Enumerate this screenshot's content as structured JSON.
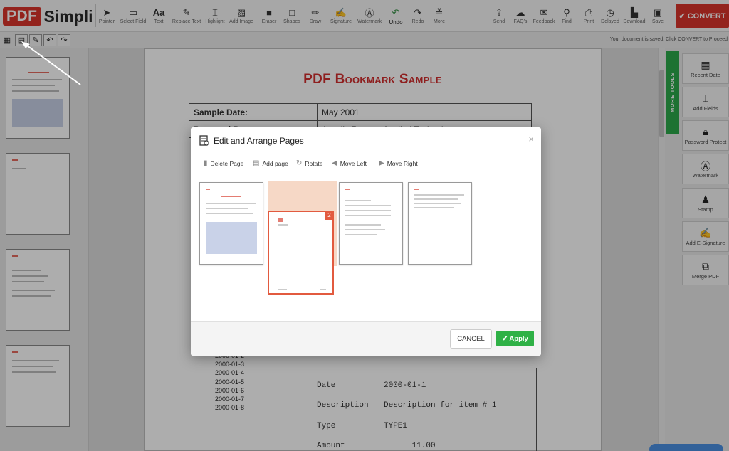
{
  "logo": {
    "pdf": "PDF",
    "simpli": "Simpli"
  },
  "toolbar": {
    "tools": [
      {
        "label": "Pointer",
        "icon": "pointer-icon"
      },
      {
        "label": "Select Field",
        "icon": "select-field-icon"
      },
      {
        "label": "Text",
        "icon": "text-icon"
      },
      {
        "label": "Replace Text",
        "icon": "replace-text-icon"
      },
      {
        "label": "Highlight",
        "icon": "highlight-icon"
      },
      {
        "label": "Add Image",
        "icon": "image-icon"
      },
      {
        "label": "Eraser",
        "icon": "eraser-icon"
      },
      {
        "label": "Shapes",
        "icon": "shapes-icon"
      },
      {
        "label": "Draw",
        "icon": "pencil-icon"
      },
      {
        "label": "Signature",
        "icon": "signature-icon"
      },
      {
        "label": "Watermark",
        "icon": "watermark-icon"
      },
      {
        "label": "Undo",
        "icon": "undo-icon"
      },
      {
        "label": "Redo",
        "icon": "redo-icon"
      },
      {
        "label": "More",
        "icon": "more-icon"
      }
    ],
    "right_tools": [
      {
        "label": "Send",
        "icon": "send-icon"
      },
      {
        "label": "FAQ's",
        "icon": "faq-icon"
      },
      {
        "label": "Feedback",
        "icon": "feedback-icon"
      },
      {
        "label": "Find",
        "icon": "search-icon"
      },
      {
        "label": "Print",
        "icon": "print-icon"
      },
      {
        "label": "Delayed",
        "icon": "clock-icon"
      },
      {
        "label": "Download",
        "icon": "download-icon"
      },
      {
        "label": "Save",
        "icon": "save-icon"
      }
    ],
    "convert_label": "✔ CONVERT"
  },
  "subbar": {
    "saved_message": "Your document is saved. Click CONVERT to Proceed"
  },
  "document": {
    "title": "PDF Bookmark Sample",
    "table": [
      {
        "label": "Sample Date:",
        "value": "May 2001"
      },
      {
        "label": "Prepared By:",
        "value": "Accelio Present Applied Technology"
      }
    ],
    "tree_items": [
      "2000-01-2",
      "2000-01-3",
      "2000-01-4",
      "2000-01-5",
      "2000-01-6",
      "2000-01-7",
      "2000-01-8"
    ],
    "record": [
      {
        "key": "Date",
        "value": "2000-01-1"
      },
      {
        "key": "Description",
        "value": "Description for item # 1"
      },
      {
        "key": "Type",
        "value": "TYPE1"
      },
      {
        "key": "Amount",
        "value": "      11.00"
      }
    ]
  },
  "right_panel": {
    "more_tools": "MORE TOOLS",
    "items": [
      {
        "label": "Recent Date",
        "icon": "calendar-icon"
      },
      {
        "label": "Add Fields",
        "icon": "add-fields-icon"
      },
      {
        "label": "Password Protect",
        "icon": "lock-icon"
      },
      {
        "label": "Watermark",
        "icon": "watermark-icon"
      },
      {
        "label": "Stamp",
        "icon": "stamp-icon"
      },
      {
        "label": "Add E-Signature",
        "icon": "e-signature-icon"
      },
      {
        "label": "Merge PDF",
        "icon": "merge-icon"
      }
    ]
  },
  "modal": {
    "title": "Edit and Arrange Pages",
    "close": "×",
    "actions": [
      {
        "label": "Delete Page",
        "icon": "trash-icon"
      },
      {
        "label": "Add page",
        "icon": "add-page-icon"
      },
      {
        "label": "Rotate",
        "icon": "rotate-icon"
      },
      {
        "label": "Move Left",
        "icon": "arrow-left-icon"
      },
      {
        "label": "Move Right",
        "icon": "arrow-right-icon"
      }
    ],
    "dragged_badge": "2",
    "cancel_label": "CANCEL",
    "apply_label": "✔ Apply"
  }
}
